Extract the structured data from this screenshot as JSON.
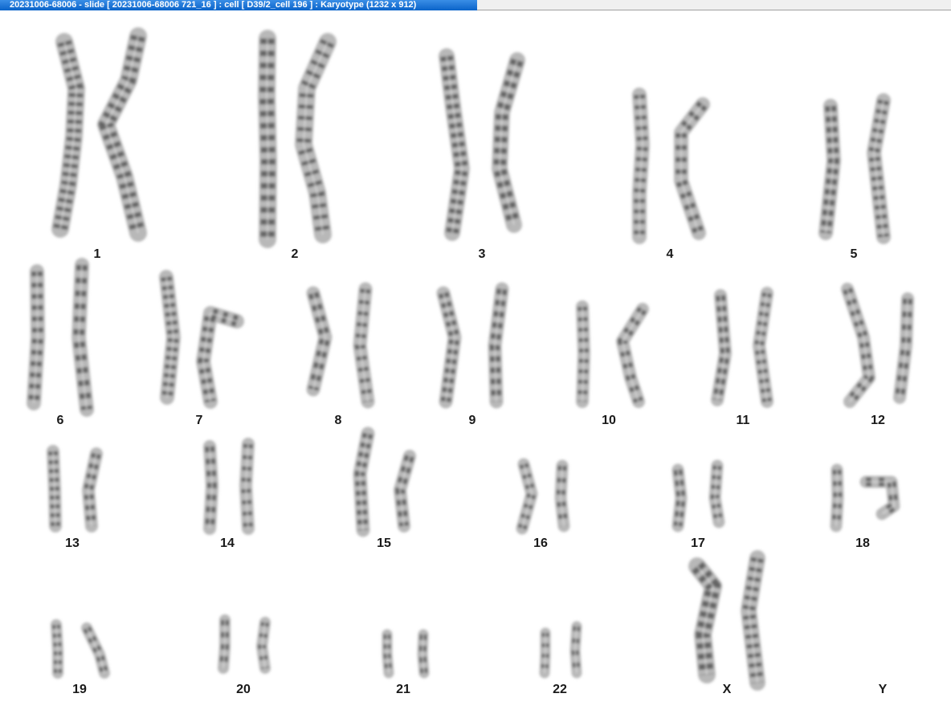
{
  "window": {
    "title": "20231006-68006 - slide [ 20231006-68006 721_16 ] : cell [ D39/2_cell 196 ] : Karyotype  (1232 x 912)"
  },
  "karyotype": {
    "labels": [
      "1",
      "2",
      "3",
      "4",
      "5",
      "6",
      "7",
      "8",
      "9",
      "10",
      "11",
      "12",
      "13",
      "14",
      "15",
      "16",
      "17",
      "18",
      "19",
      "20",
      "21",
      "22",
      "X",
      "Y"
    ]
  }
}
